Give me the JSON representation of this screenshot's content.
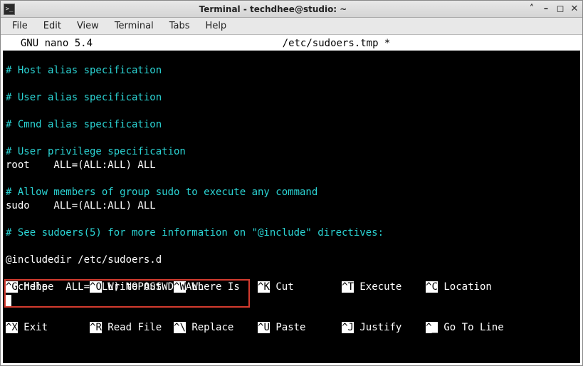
{
  "window": {
    "title": "Terminal - techdhee@studio: ~",
    "icon_glyph": ">_"
  },
  "window_controls": {
    "up": "˄",
    "min": "–",
    "max": "◻",
    "close": "✕"
  },
  "menubar": [
    "File",
    "Edit",
    "View",
    "Terminal",
    "Tabs",
    "Help"
  ],
  "nano": {
    "version": "  GNU nano 5.4",
    "filename": "/etc/sudoers.tmp *"
  },
  "lines": [
    {
      "cls": "comment",
      "text": ""
    },
    {
      "cls": "comment",
      "text": "# Host alias specification"
    },
    {
      "cls": "comment",
      "text": ""
    },
    {
      "cls": "comment",
      "text": "# User alias specification"
    },
    {
      "cls": "comment",
      "text": ""
    },
    {
      "cls": "comment",
      "text": "# Cmnd alias specification"
    },
    {
      "cls": "comment",
      "text": ""
    },
    {
      "cls": "comment",
      "text": "# User privilege specification"
    },
    {
      "cls": "normal",
      "text": "root    ALL=(ALL:ALL) ALL"
    },
    {
      "cls": "comment",
      "text": ""
    },
    {
      "cls": "comment",
      "text": "# Allow members of group sudo to execute any command"
    },
    {
      "cls": "normal",
      "text": "sudo    ALL=(ALL:ALL) ALL"
    },
    {
      "cls": "comment",
      "text": ""
    },
    {
      "cls": "comment",
      "text": "# See sudoers(5) for more information on \"@include\" directives:"
    },
    {
      "cls": "comment",
      "text": ""
    },
    {
      "cls": "normal",
      "text": "@includedir /etc/sudoers.d"
    },
    {
      "cls": "normal",
      "text": ""
    },
    {
      "cls": "normal",
      "text": "techdhee  ALL=(ALL) NOPASSWD: ALL"
    }
  ],
  "shortcuts_row1": [
    {
      "key": "^G",
      "label": "Help"
    },
    {
      "key": "^O",
      "label": "Write Out"
    },
    {
      "key": "^W",
      "label": "Where Is"
    },
    {
      "key": "^K",
      "label": "Cut"
    },
    {
      "key": "^T",
      "label": "Execute"
    },
    {
      "key": "^C",
      "label": "Location"
    }
  ],
  "shortcuts_row2": [
    {
      "key": "^X",
      "label": "Exit"
    },
    {
      "key": "^R",
      "label": "Read File"
    },
    {
      "key": "^\\",
      "label": "Replace"
    },
    {
      "key": "^U",
      "label": "Paste"
    },
    {
      "key": "^J",
      "label": "Justify"
    },
    {
      "key": "^_",
      "label": "Go To Line"
    }
  ]
}
